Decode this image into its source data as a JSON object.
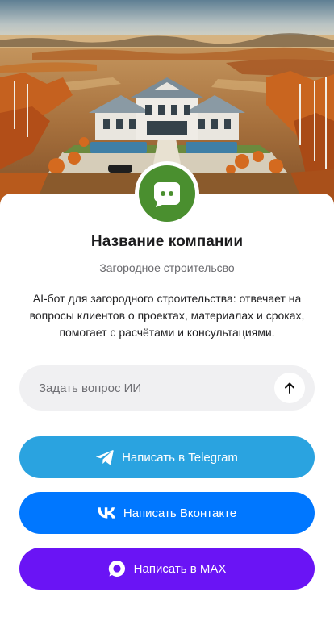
{
  "colors": {
    "brand": "#4a8f2f",
    "telegram": "#2aa3e0",
    "vk": "#0077ff",
    "max": "#6a14f5"
  },
  "hero": {
    "description_icon": "estate-illustration"
  },
  "logo": {
    "icon": "chat-bot-icon"
  },
  "company": {
    "name": "Название компании",
    "category": "Загородное строительсво",
    "description": "AI-бот для загородного строительства: отвечает на вопросы клиентов о проектах, материалах и сроках, помогает с расчётами и консультациями."
  },
  "ask": {
    "placeholder": "Задать вопрос ИИ",
    "value": "",
    "send_icon": "arrow-up-icon"
  },
  "buttons": {
    "telegram": {
      "label": "Написать в Telegram",
      "icon": "telegram-icon"
    },
    "vk": {
      "label": "Написать Вконтакте",
      "icon": "vk-icon"
    },
    "max": {
      "label": "Написать в MAX",
      "icon": "max-icon"
    }
  }
}
